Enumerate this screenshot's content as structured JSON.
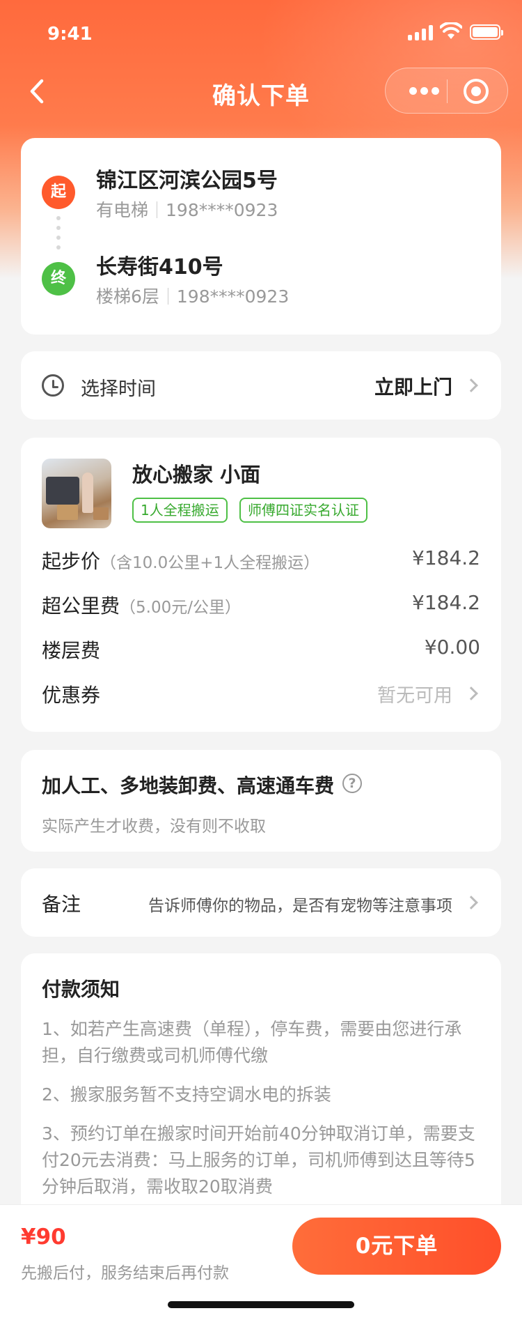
{
  "status_bar": {
    "time": "9:41"
  },
  "nav": {
    "title": "确认下单"
  },
  "address": {
    "start": {
      "badge": "起",
      "name": "锦江区河滨公园5号",
      "floor": "有电梯",
      "phone": "198****0923"
    },
    "end": {
      "badge": "终",
      "name": "长寿街410号",
      "floor": "楼梯6层",
      "phone": "198****0923"
    }
  },
  "time_select": {
    "label": "选择时间",
    "value": "立即上门"
  },
  "service": {
    "name": "放心搬家 小面",
    "tags": [
      "1人全程搬运",
      "师傅四证实名认证"
    ]
  },
  "fees": [
    {
      "label": "起步价",
      "hint": "（含10.0公里+1人全程搬运）",
      "value": "¥184.2"
    },
    {
      "label": "超公里费",
      "hint": "（5.00元/公里）",
      "value": "¥184.2"
    },
    {
      "label": "楼层费",
      "hint": "",
      "value": "¥0.00"
    }
  ],
  "coupon": {
    "label": "优惠券",
    "value": "暂无可用"
  },
  "extra": {
    "title": "加人工、多地装卸费、高速通车费",
    "help": "?",
    "desc": "实际产生才收费，没有则不收取"
  },
  "remark": {
    "label": "备注",
    "placeholder": "告诉师傅你的物品，是否有宠物等注意事项"
  },
  "notice": {
    "title": "付款须知",
    "items": [
      "1、如若产生高速费（单程），停车费，需要由您进行承担，自行缴费或司机师傅代缴",
      "2、搬家服务暂不支持空调水电的拆装",
      "3、预约订单在搬家时间开始前40分钟取消订单，需要支付20元去消费：马上服务的订单，司机师傅到达且等待5分钟后取消，需收取20取消费"
    ]
  },
  "footer": {
    "total": "¥90",
    "sub": "先搬后付，服务结束后再付款",
    "submit": "0元下单"
  },
  "colors": {
    "accent": "#ff5a2c",
    "green": "#4ec046",
    "price_red": "#ff3b30"
  }
}
